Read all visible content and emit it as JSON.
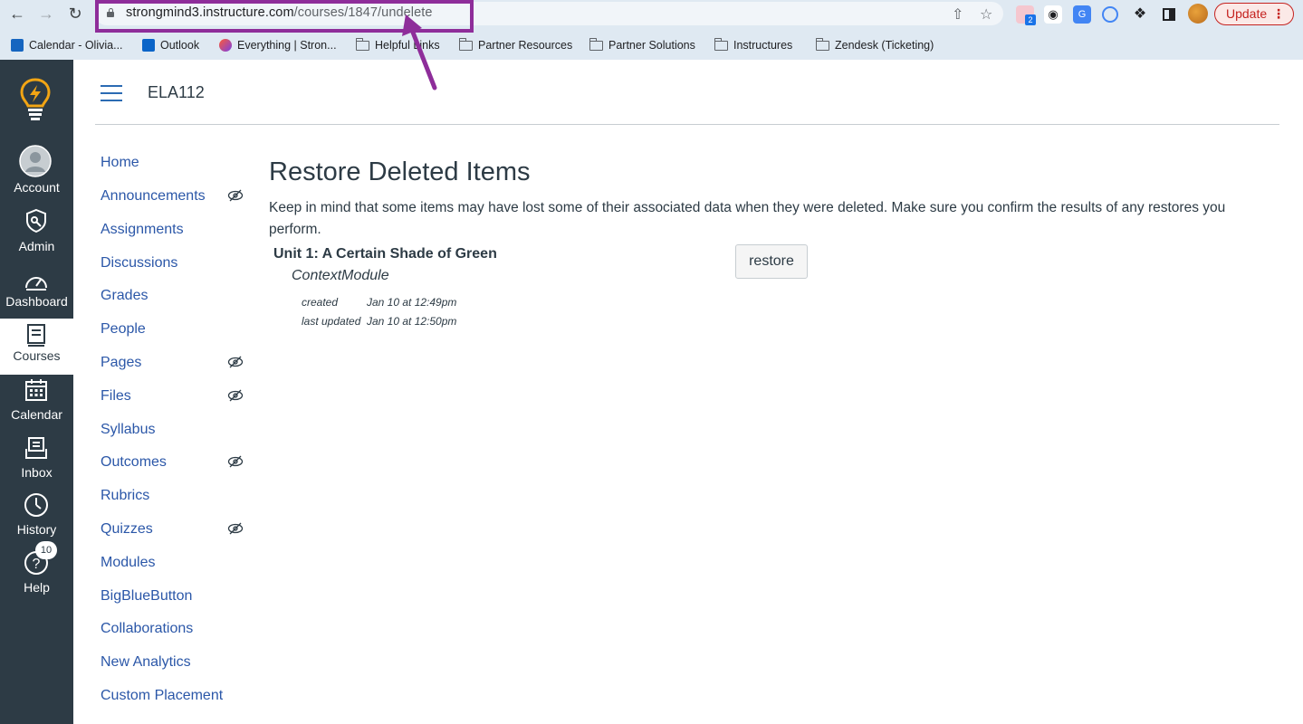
{
  "browser": {
    "url_host": "strongmind3.instructure.com",
    "url_path": "/courses/1847/undelete",
    "update_label": "Update",
    "extension_badge": "2",
    "bookmarks": [
      {
        "label": "Calendar - Olivia...",
        "icon": "calendar-favicon"
      },
      {
        "label": "Outlook",
        "icon": "outlook-favicon"
      },
      {
        "label": "Everything | Stron...",
        "icon": "strongmind-favicon"
      },
      {
        "label": "Helpful Links",
        "icon": "folder-icon"
      },
      {
        "label": "Partner Resources",
        "icon": "folder-icon"
      },
      {
        "label": "Partner Solutions",
        "icon": "folder-icon"
      },
      {
        "label": "Instructures",
        "icon": "folder-icon"
      },
      {
        "label": "Zendesk (Ticketing)",
        "icon": "folder-icon"
      }
    ],
    "annotation_color": "#8e2d9a"
  },
  "global_nav": {
    "items": [
      {
        "label": "Account",
        "icon": "avatar-icon"
      },
      {
        "label": "Admin",
        "icon": "shield-icon"
      },
      {
        "label": "Dashboard",
        "icon": "dashboard-icon"
      },
      {
        "label": "Courses",
        "icon": "courses-icon"
      },
      {
        "label": "Calendar",
        "icon": "calendar-icon"
      },
      {
        "label": "Inbox",
        "icon": "inbox-icon"
      },
      {
        "label": "History",
        "icon": "clock-icon"
      },
      {
        "label": "Help",
        "icon": "help-icon"
      }
    ],
    "help_badge": "10",
    "bg_color": "#2d3b45"
  },
  "course": {
    "title": "ELA112"
  },
  "course_nav": {
    "items": [
      {
        "label": "Home",
        "hidden": false
      },
      {
        "label": "Announcements",
        "hidden": true
      },
      {
        "label": "Assignments",
        "hidden": false
      },
      {
        "label": "Discussions",
        "hidden": false
      },
      {
        "label": "Grades",
        "hidden": false
      },
      {
        "label": "People",
        "hidden": false
      },
      {
        "label": "Pages",
        "hidden": true
      },
      {
        "label": "Files",
        "hidden": true
      },
      {
        "label": "Syllabus",
        "hidden": false
      },
      {
        "label": "Outcomes",
        "hidden": true
      },
      {
        "label": "Rubrics",
        "hidden": false
      },
      {
        "label": "Quizzes",
        "hidden": true
      },
      {
        "label": "Modules",
        "hidden": false
      },
      {
        "label": "BigBlueButton",
        "hidden": false
      },
      {
        "label": "Collaborations",
        "hidden": false
      },
      {
        "label": "New Analytics",
        "hidden": false
      },
      {
        "label": "Custom Placement",
        "hidden": false
      }
    ],
    "link_color": "#2b57a8"
  },
  "main": {
    "title": "Restore Deleted Items",
    "intro": "Keep in mind that some items may have lost some of their associated data when they were deleted. Make sure you confirm the results of any restores you perform.",
    "item": {
      "title": "Unit 1: A Certain Shade of Green",
      "type": "ContextModule",
      "created_label": "created",
      "created_value": "Jan 10 at 12:49pm",
      "updated_label": "last updated",
      "updated_value": "Jan 10 at 12:50pm",
      "restore_label": "restore"
    }
  }
}
